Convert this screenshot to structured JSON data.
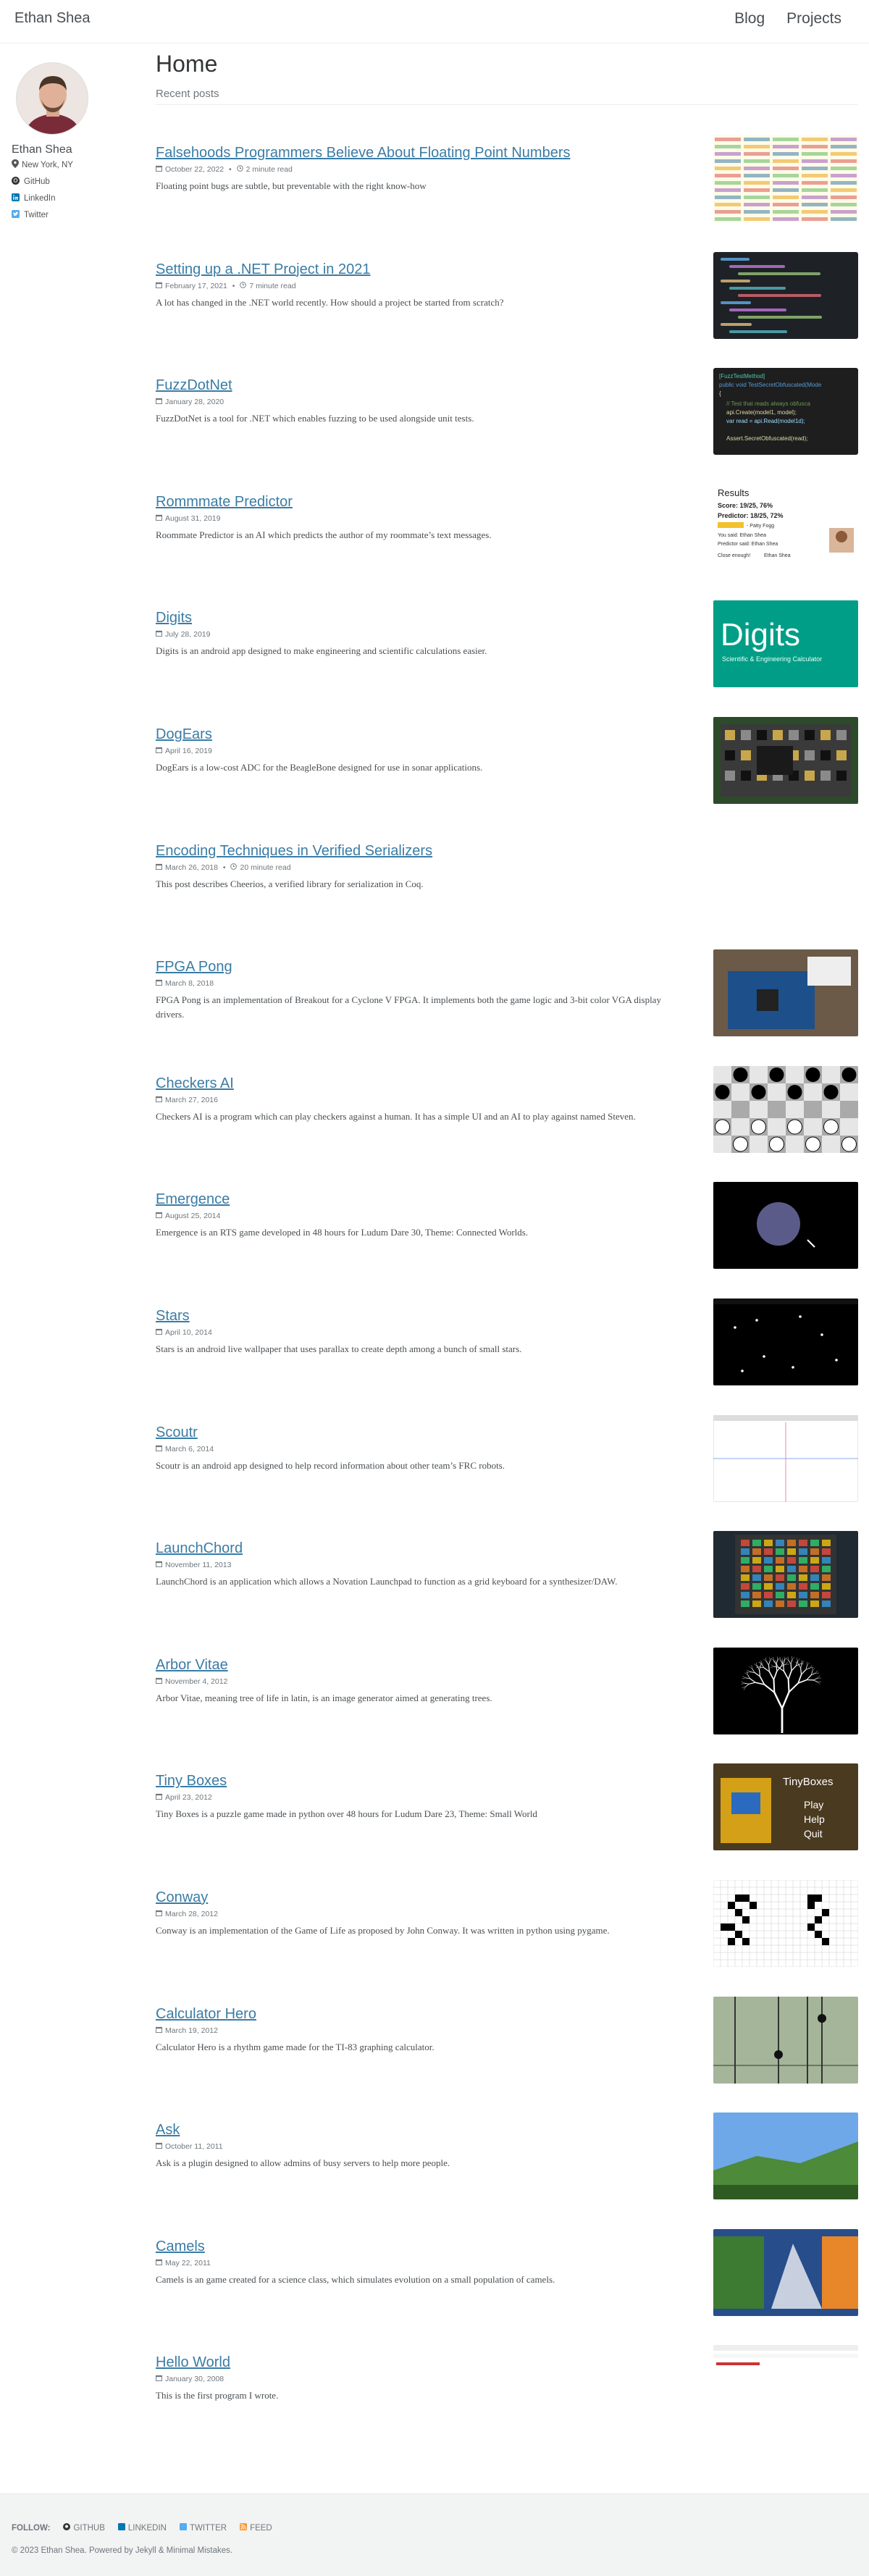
{
  "header": {
    "site_title": "Ethan Shea",
    "nav": [
      "Blog",
      "Projects"
    ]
  },
  "sidebar": {
    "name": "Ethan Shea",
    "location": "New York, NY",
    "links": [
      {
        "label": "GitHub",
        "icon": "github-icon"
      },
      {
        "label": "LinkedIn",
        "icon": "linkedin-icon"
      },
      {
        "label": "Twitter",
        "icon": "twitter-icon"
      }
    ]
  },
  "main": {
    "title": "Home",
    "section": "Recent posts"
  },
  "posts": [
    {
      "title": "Falsehoods Programmers Believe About Floating Point Numbers",
      "date": "October 22, 2022",
      "read": "2 minute read",
      "excerpt": "Floating point bugs are subtle, but preventable with the right know-how"
    },
    {
      "title": "Setting up a .NET Project in 2021",
      "date": "February 17, 2021",
      "read": "7 minute read",
      "excerpt": "A lot has changed in the .NET world recently. How should a project be started from scratch?"
    },
    {
      "title": "FuzzDotNet",
      "date": "January 28, 2020",
      "read": "",
      "excerpt": "FuzzDotNet is a tool for .NET which enables fuzzing to be used alongside unit tests."
    },
    {
      "title": "Rommmate Predictor",
      "date": "August 31, 2019",
      "read": "",
      "excerpt": "Roommate Predictor is an AI which predicts the author of my roommate’s text messages."
    },
    {
      "title": "Digits",
      "date": "July 28, 2019",
      "read": "",
      "excerpt": "Digits is an android app designed to make engineering and scientific calculations easier."
    },
    {
      "title": "DogEars",
      "date": "April 16, 2019",
      "read": "",
      "excerpt": "DogEars is a low-cost ADC for the BeagleBone designed for use in sonar applications."
    },
    {
      "title": "Encoding Techniques in Verified Serializers",
      "date": "March 26, 2018",
      "read": "20 minute read",
      "excerpt": "This post describes Cheerios, a verified library for serialization in Coq."
    },
    {
      "title": "FPGA Pong",
      "date": "March 8, 2018",
      "read": "",
      "excerpt": "FPGA Pong is an implementation of Breakout for a Cyclone V FPGA. It implements both the game logic and 3-bit color VGA display drivers."
    },
    {
      "title": "Checkers AI",
      "date": "March 27, 2016",
      "read": "",
      "excerpt": "Checkers AI is a program which can play checkers against a human. It has a simple UI and an AI to play against named Steven."
    },
    {
      "title": "Emergence",
      "date": "August 25, 2014",
      "read": "",
      "excerpt": "Emergence is an RTS game developed in 48 hours for Ludum Dare 30, Theme: Connected Worlds."
    },
    {
      "title": "Stars",
      "date": "April 10, 2014",
      "read": "",
      "excerpt": "Stars is an android live wallpaper that uses parallax to create depth among a bunch of small stars."
    },
    {
      "title": "Scoutr",
      "date": "March 6, 2014",
      "read": "",
      "excerpt": "Scoutr is an android app designed to help record information about other team’s FRC robots."
    },
    {
      "title": "LaunchChord",
      "date": "November 11, 2013",
      "read": "",
      "excerpt": "LaunchChord is an application which allows a Novation Launchpad to function as a grid keyboard for a synthesizer/DAW."
    },
    {
      "title": "Arbor Vitae",
      "date": "November 4, 2012",
      "read": "",
      "excerpt": "Arbor Vitae, meaning tree of life in latin, is an image generator aimed at generating trees."
    },
    {
      "title": "Tiny Boxes",
      "date": "April 23, 2012",
      "read": "",
      "excerpt": "Tiny Boxes is a puzzle game made in python over 48 hours for Ludum Dare 23, Theme: Small World"
    },
    {
      "title": "Conway",
      "date": "March 28, 2012",
      "read": "",
      "excerpt": "Conway is an implementation of the Game of Life as proposed by John Conway. It was written in python using pygame."
    },
    {
      "title": "Calculator Hero",
      "date": "March 19, 2012",
      "read": "",
      "excerpt": "Calculator Hero is a rhythm game made for the TI-83 graphing calculator."
    },
    {
      "title": "Ask",
      "date": "October 11, 2011",
      "read": "",
      "excerpt": "Ask is a plugin designed to allow admins of busy servers to help more people."
    },
    {
      "title": "Camels",
      "date": "May 22, 2011",
      "read": "",
      "excerpt": "Camels is an game created for a science class, which simulates evolution on a small population of camels."
    },
    {
      "title": "Hello World",
      "date": "January 30, 2008",
      "read": "",
      "excerpt": "This is the first program I wrote."
    }
  ],
  "thumbs": {
    "roommate": {
      "title": "Results",
      "score": "Score: 19/25, 76%",
      "predictor": "Predictor: 18/25, 72%",
      "caption": "- Patty Fogg",
      "said": "You said: Ethan Shea",
      "pred": "Predictor said: Ethan Shea",
      "q": "Close enough!",
      "who": "Ethan Shea"
    },
    "digits": {
      "name": "Digits",
      "tag": "Scientific & Engineering Calculator"
    },
    "tinyboxes": {
      "name": "TinyBoxes",
      "m1": "Play",
      "m2": "Help",
      "m3": "Quit"
    },
    "code1": {
      "l1": "[FuzzTestMethod]",
      "l2": "public void TestSecretObfuscated(Mode",
      "l3": "{",
      "l4": "// Test that reads always obfusca",
      "l5": "api.Create(model1, model);",
      "l6": "var read = api.Read(model1d);",
      "l7": "Assert.SecretObfuscated(read);"
    }
  },
  "footer": {
    "follow": "FOLLOW:",
    "links": [
      "GITHUB",
      "LINKEDIN",
      "TWITTER",
      "FEED"
    ],
    "copyright": "© 2023 Ethan Shea. Powered by Jekyll & Minimal Mistakes."
  },
  "colors": {
    "link": "#3a7ca5",
    "text": "#494e52",
    "muted": "#6f777d",
    "footer_bg": "#f2f3f3"
  }
}
